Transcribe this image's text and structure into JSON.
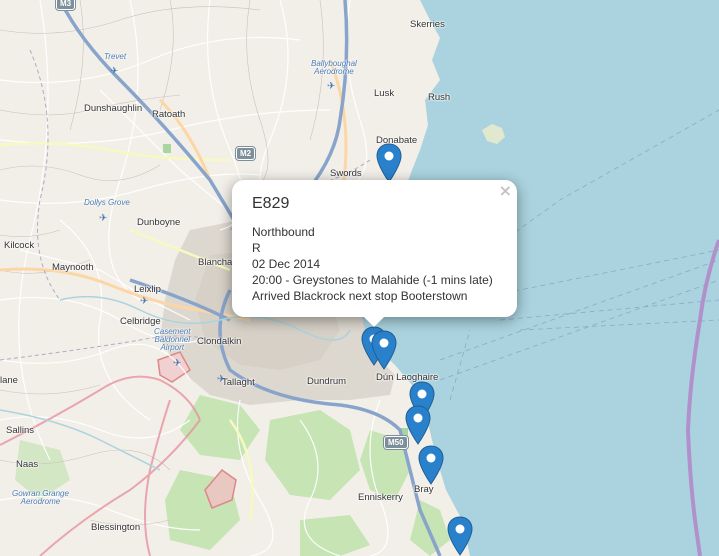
{
  "map": {
    "places": {
      "skerries": "Skerries",
      "lusk": "Lusk",
      "rush": "Rush",
      "donabate": "Donabate",
      "swords": "Swords",
      "dunshaughlin": "Dunshaughlin",
      "ratoath": "Ratoath",
      "dunboyne": "Dunboyne",
      "kilcock": "Kilcock",
      "maynooth": "Maynooth",
      "leixlip": "Leixlip",
      "celbridge": "Celbridge",
      "blanchardstown": "Blanchar",
      "clondalkin": "Clondalkin",
      "tallaght": "Tallaght",
      "dundrum": "Dundrum",
      "dun_laoghaire": "Dún Laoghaire",
      "sallins": "Sallins",
      "naas": "Naas",
      "enniskerry": "Enniskerry",
      "bray": "Bray",
      "blessington": "Blessington",
      "lane": "lane"
    },
    "airfields": {
      "trevet": "Trevet",
      "ballyboughal": "Ballyboughal\nAerodrome",
      "dollys_grove": "Dollys Grove",
      "casement": "Casement\nBaldonnel\nAirport",
      "gowran": "Gowran Grange\nAerodrome"
    },
    "roads": {
      "m3": "M3",
      "m2": "M2",
      "m50": "M50"
    }
  },
  "popup": {
    "title": "E829",
    "close_label": "×",
    "direction": "Northbound",
    "route": "R",
    "date": "02 Dec 2014",
    "service": "20:00 - Greystones to Malahide (-1 mins late)",
    "status": "Arrived Blackrock next stop Booterstown"
  },
  "markers": {
    "color": "#2a81cb",
    "count": 7
  }
}
